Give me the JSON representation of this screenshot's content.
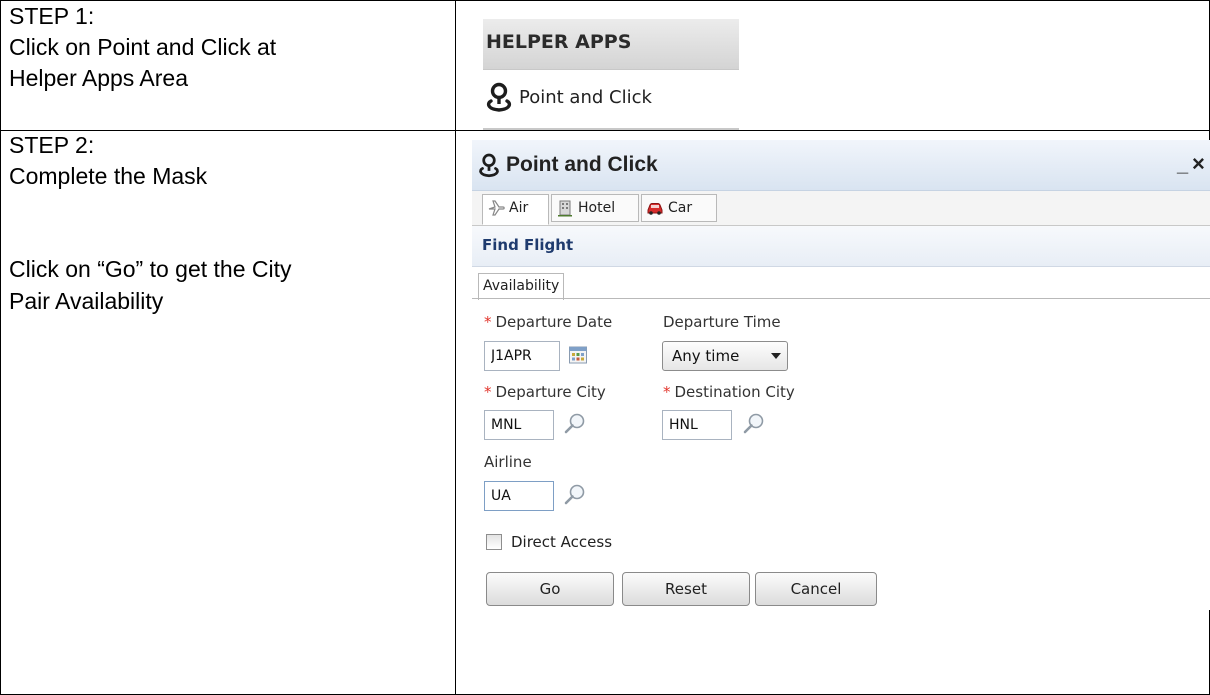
{
  "steps": [
    {
      "lines": [
        "STEP 1:",
        "Click on Point and Click at",
        "Helper Apps Area"
      ]
    },
    {
      "lines": [
        "STEP 2:",
        "Complete the Mask",
        "",
        "Click on “Go” to get the City",
        "Pair Availability"
      ]
    }
  ],
  "helper_apps": {
    "header": "HELPER APPS",
    "item_label": "Point and Click",
    "item_icon": "map-pin-icon"
  },
  "panel": {
    "title": "Point and Click",
    "minimize_glyph": "_",
    "close_glyph": "×",
    "tabs": [
      {
        "label": "Air",
        "icon": "airplane-icon",
        "active": true
      },
      {
        "label": "Hotel",
        "icon": "building-icon",
        "active": false
      },
      {
        "label": "Car",
        "icon": "car-icon",
        "active": false
      }
    ],
    "section_title": "Find Flight",
    "subtab": "Availability",
    "required_marker": "*",
    "fields": {
      "departure_date": {
        "label": "Departure Date",
        "value": "J1APR",
        "required": true
      },
      "departure_time": {
        "label": "Departure Time",
        "value": "Any time",
        "required": false
      },
      "departure_city": {
        "label": "Departure City",
        "value": "MNL",
        "required": true
      },
      "destination_city": {
        "label": "Destination City",
        "value": "HNL",
        "required": true
      },
      "airline": {
        "label": "Airline",
        "value": "UA",
        "required": false
      }
    },
    "direct_access": {
      "label": "Direct Access",
      "checked": false
    },
    "buttons": {
      "go": "Go",
      "reset": "Reset",
      "cancel": "Cancel"
    }
  },
  "colors": {
    "required": "#e2342b",
    "section_title": "#1f3b6e",
    "titlebar": "#d9e4f1"
  }
}
